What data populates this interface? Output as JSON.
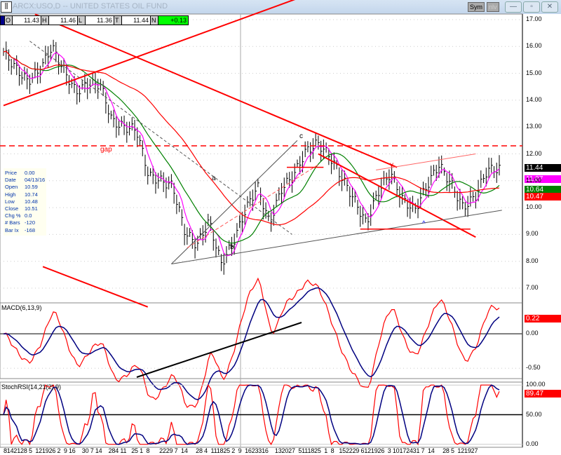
{
  "window": {
    "title": "ARCX:USO,D -- UNITED STATES OIL FUND",
    "sym_label": "Sym",
    "nlv_label": "nlv",
    "minimize": "—",
    "maximize": "▫",
    "close": "✕"
  },
  "ohlc_bar": {
    "O": "11.43",
    "H": "11.46",
    "L": "11.36",
    "T": "11.44",
    "N": "+0.13",
    "labels": [
      "O",
      "H",
      "L",
      "T",
      "N"
    ]
  },
  "info_box": [
    {
      "k": "Price",
      "v": "0.00"
    },
    {
      "k": "Date",
      "v": "04/13/16"
    },
    {
      "k": "Open",
      "v": "10.59"
    },
    {
      "k": "High",
      "v": "10.74"
    },
    {
      "k": "Low",
      "v": "10.48"
    },
    {
      "k": "Close",
      "v": "10.51"
    },
    {
      "k": "Chg %",
      "v": "0.0"
    },
    {
      "k": "# Bars",
      "v": "-120"
    },
    {
      "k": "Bar Ix",
      "v": "-168"
    }
  ],
  "price_tags": [
    {
      "v": "11.44",
      "color": "#000000"
    },
    {
      "v": "11.07",
      "color": "#ff00ff"
    },
    {
      "v": "10.64",
      "color": "#008000"
    },
    {
      "v": "10.47",
      "color": "#ff0000"
    }
  ],
  "macd_tags": [
    {
      "v": "0.22",
      "color": "#ff0000"
    }
  ],
  "stoch_tags": [
    {
      "v": "89.47",
      "color": "#ff0000"
    }
  ],
  "dates_text": "8142128 5  121926 2  9 16    30 7 14    284 11   25 1  8      2229 7  14     28 4  111825 2  9  1623316    132027  5111825  1  8   152229 6121926  3 10172431 7  14     28 5  121927",
  "chart_data": [
    {
      "type": "line",
      "panel": "price",
      "title": "ARCX:USO,D",
      "ylim": [
        6.5,
        17.2
      ],
      "yticks": [
        "17.00",
        "16.00",
        "15.00",
        "14.00",
        "13.00",
        "12.00",
        "11.00",
        "10.00",
        "9.00",
        "8.00",
        "7.00"
      ],
      "close": [
        15.8,
        15.2,
        14.7,
        15.1,
        16.0,
        15.1,
        14.3,
        14.6,
        14.6,
        13.2,
        13.0,
        12.9,
        11.2,
        11.0,
        10.8,
        9.1,
        8.6,
        9.5,
        7.9,
        8.7,
        9.9,
        10.8,
        9.4,
        10.7,
        11.2,
        12.1,
        12.4,
        11.9,
        11.1,
        10.3,
        9.4,
        10.6,
        11.3,
        10.3,
        9.9,
        10.8,
        11.6,
        10.9,
        10.0,
        10.4,
        11.4,
        11.44
      ],
      "series_colors": {
        "price": "#000000",
        "ma_fast": "#ff00ff",
        "ma_mid": "#008000",
        "ma_slow": "#ff0000"
      },
      "annotations": [
        "gap",
        "a",
        "b",
        "c",
        "v",
        "^"
      ],
      "gap_level": 12.3
    },
    {
      "type": "line",
      "panel": "macd",
      "title": "MACD(6,13,9)",
      "yticks": [
        "0.00",
        "-0.50"
      ],
      "ylim": [
        -0.65,
        0.45
      ],
      "colors": {
        "macd": "#ff0000",
        "signal": "#000080"
      },
      "annotations": [
        "v",
        "^"
      ]
    },
    {
      "type": "line",
      "panel": "stochrsi",
      "title": "StochRSI(14,21(2),9)",
      "yticks": [
        "100.00",
        "50.00",
        "0.00"
      ],
      "ylim": [
        -5,
        105
      ],
      "colors": {
        "k": "#ff0000",
        "d": "#000080"
      },
      "annotations": [
        "^"
      ]
    }
  ]
}
